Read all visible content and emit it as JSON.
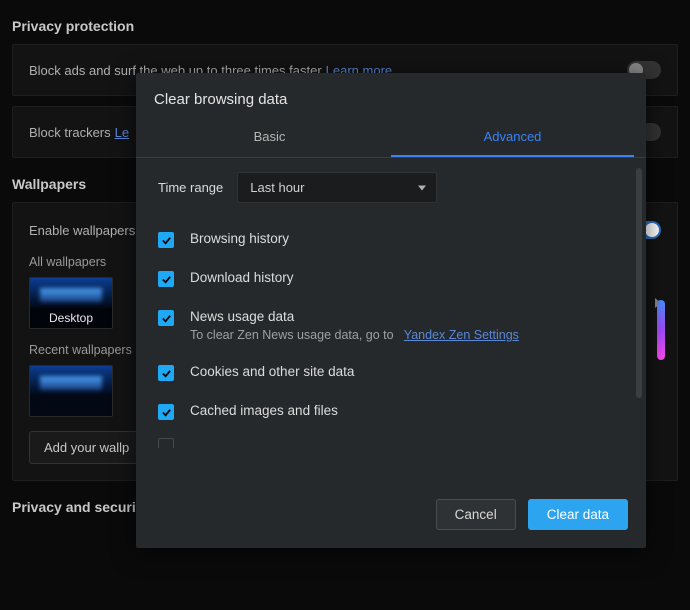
{
  "sections": {
    "privacy_protection": "Privacy protection",
    "wallpapers": "Wallpapers",
    "privacy_security": "Privacy and security"
  },
  "ad_row": {
    "label": "Block ads and surf the web up to three times faster",
    "learn_more": "Learn more"
  },
  "trackers_row": {
    "label": "Block trackers",
    "learn_more_truncated": "Le"
  },
  "wallpapers_panel": {
    "enable": "Enable wallpapers",
    "all": "All wallpapers",
    "recent": "Recent wallpapers",
    "thumb_label": "Desktop",
    "add_button": "Add your wallp"
  },
  "modal": {
    "title": "Clear browsing data",
    "tabs": {
      "basic": "Basic",
      "advanced": "Advanced"
    },
    "time_range_label": "Time range",
    "time_range_value": "Last hour",
    "items": [
      {
        "title": "Browsing history",
        "sub": "",
        "link": ""
      },
      {
        "title": "Download history",
        "sub": "",
        "link": ""
      },
      {
        "title": "News usage data",
        "sub": "To clear Zen News usage data, go to",
        "link": "Yandex Zen Settings"
      },
      {
        "title": "Cookies and other site data",
        "sub": "",
        "link": ""
      },
      {
        "title": "Cached images and files",
        "sub": "",
        "link": ""
      }
    ],
    "footer": {
      "cancel": "Cancel",
      "clear": "Clear data"
    }
  }
}
